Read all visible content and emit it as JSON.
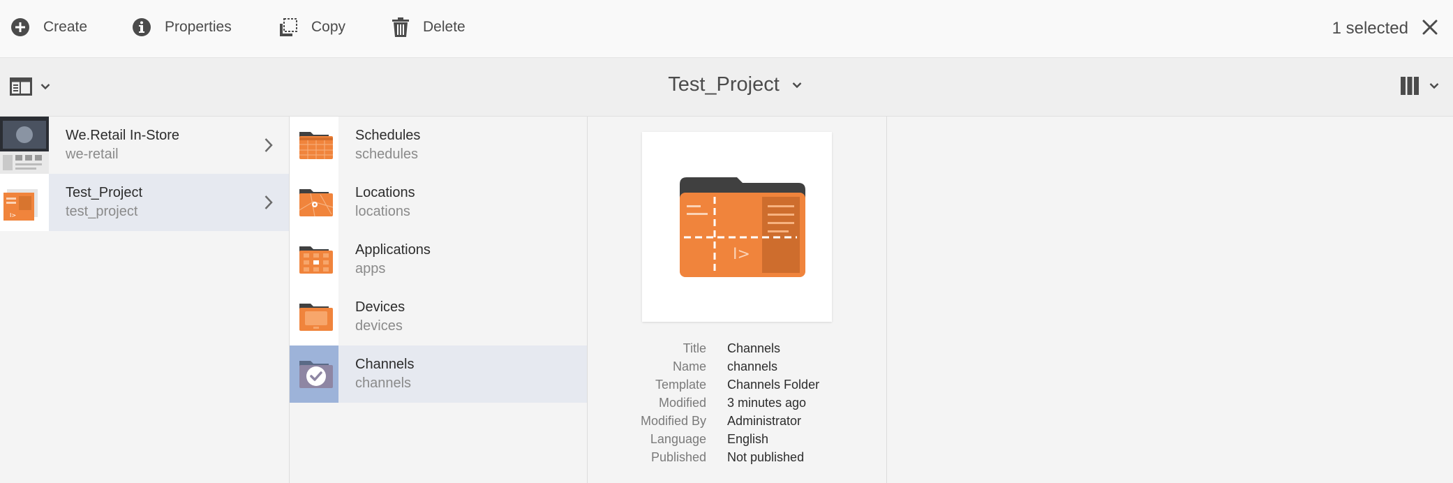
{
  "actionbar": {
    "actions": [
      {
        "label": "Create",
        "icon": "add-circle-icon"
      },
      {
        "label": "Properties",
        "icon": "info-icon"
      },
      {
        "label": "Copy",
        "icon": "copy-icon"
      },
      {
        "label": "Delete",
        "icon": "trash-icon"
      }
    ],
    "selected_text": "1 selected",
    "close_icon": "close-icon"
  },
  "titlebar": {
    "title": "Test_Project",
    "rail_icon": "rail-toggle-icon",
    "view_icon": "column-view-icon"
  },
  "columns": {
    "projects": [
      {
        "title": "We.Retail In-Store",
        "subtitle": "we-retail",
        "active": false
      },
      {
        "title": "Test_Project",
        "subtitle": "test_project",
        "active": true
      }
    ],
    "folders": [
      {
        "title": "Schedules",
        "subtitle": "schedules",
        "icon": "schedules-folder-icon"
      },
      {
        "title": "Locations",
        "subtitle": "locations",
        "icon": "locations-folder-icon"
      },
      {
        "title": "Applications",
        "subtitle": "apps",
        "icon": "applications-folder-icon"
      },
      {
        "title": "Devices",
        "subtitle": "devices",
        "icon": "devices-folder-icon"
      },
      {
        "title": "Channels",
        "subtitle": "channels",
        "icon": "checkmark-icon",
        "selected": true
      }
    ]
  },
  "details": {
    "preview_icon": "channels-folder-icon",
    "meta": [
      {
        "label": "Title",
        "value": "Channels"
      },
      {
        "label": "Name",
        "value": "channels"
      },
      {
        "label": "Template",
        "value": "Channels Folder"
      },
      {
        "label": "Modified",
        "value": "3 minutes ago"
      },
      {
        "label": "Modified By",
        "value": "Administrator"
      },
      {
        "label": "Language",
        "value": "English"
      },
      {
        "label": "Published",
        "value": "Not published"
      }
    ]
  },
  "colors": {
    "accent_orange": "#f0843c",
    "folder_dark": "#404040",
    "selection_blue": "#9db3d9",
    "selected_row": "#e6e9f0"
  }
}
